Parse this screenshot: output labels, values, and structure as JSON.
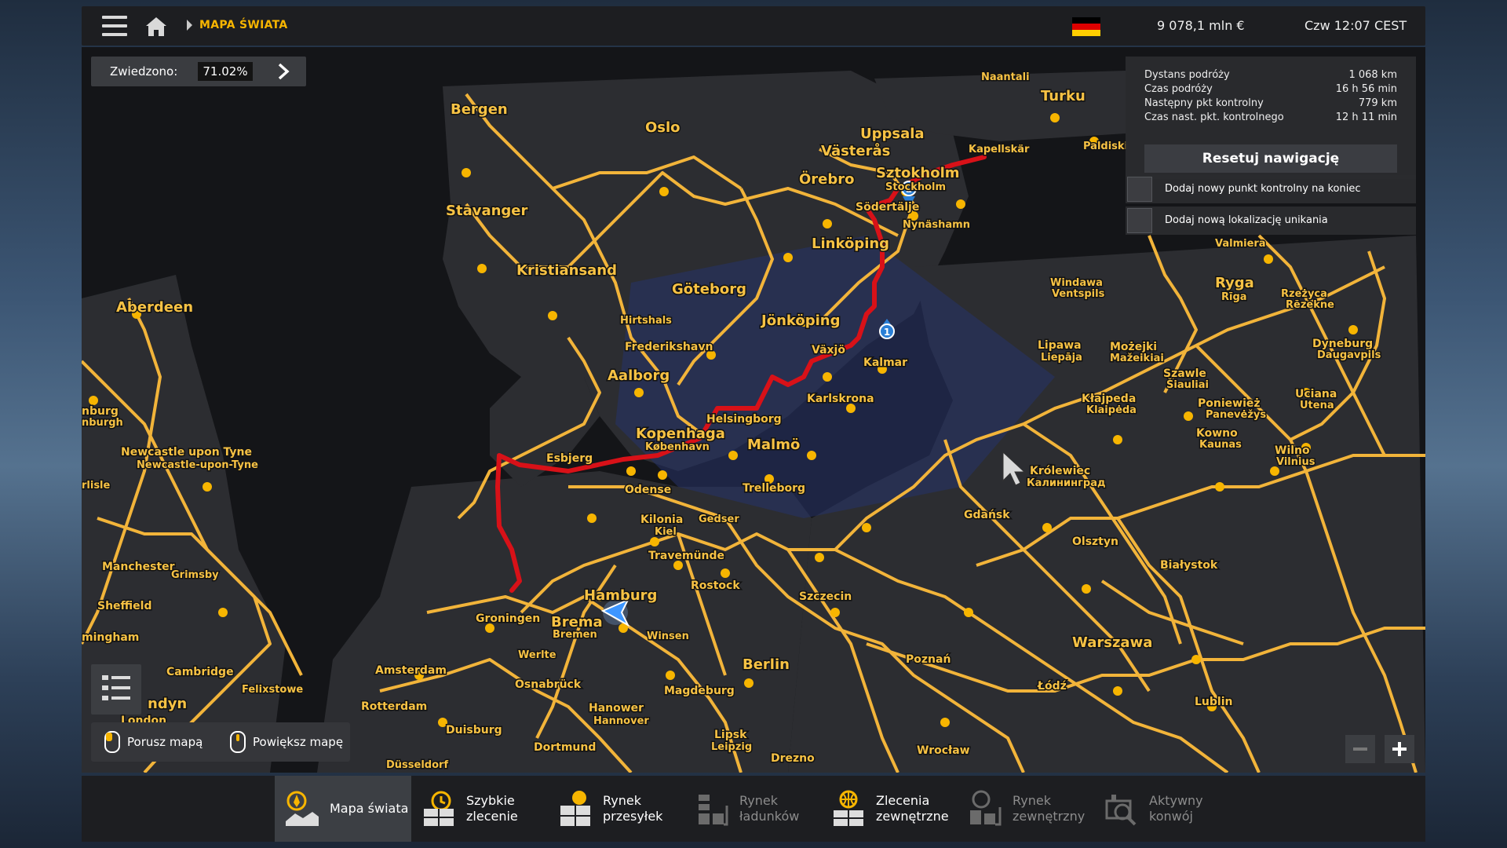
{
  "header": {
    "breadcrumb": "MAPA ŚWIATA",
    "money": "9 078,1 mln  €",
    "clock": "Czw 12:07 CEST",
    "flag_colors": [
      "#000000",
      "#dd0000",
      "#ffce00"
    ]
  },
  "visited": {
    "label": "Zwiedzono:",
    "value": "71.02%"
  },
  "navigation": {
    "rows": [
      {
        "label": "Dystans podróży",
        "value": "1 068 km"
      },
      {
        "label": "Czas podróży",
        "value": "16 h 56 min"
      },
      {
        "label": "Następny pkt kontrolny",
        "value": "779 km"
      },
      {
        "label": "Czas nast. pkt. kontrolnego",
        "value": "12 h 11 min"
      }
    ],
    "reset_label": "Resetuj nawigację",
    "options": [
      "Dodaj nowy punkt kontrolny na koniec",
      "Dodaj nową lokalizację unikania"
    ]
  },
  "map": {
    "route_color": "#d81118",
    "road_color": "#f2b43a",
    "waypoints": [
      "1",
      "2"
    ],
    "labels": {
      "bergen": "Bergen",
      "oslo": "Oslo",
      "stavanger": "Stavanger",
      "kristiansand": "Kristiansand",
      "aberdeen": "Aberdeen",
      "uppsala": "Uppsala",
      "vasteras": "Västerås",
      "orebro": "Örebro",
      "sztokholm": "Sztokholm",
      "stockholm": "Stockholm",
      "sodertalje": "Södertälje",
      "nynashamn": "Nynäshamn",
      "kapellskar": "Kapellskär",
      "naantali": "Naantali",
      "turku": "Turku",
      "paldiski": "Paldiski",
      "linkoping": "Linköping",
      "goteborg": "Göteborg",
      "jonkoping": "Jönköping",
      "hirtshals": "Hirtshals",
      "frederikshavn": "Frederikshavn",
      "vaxjo": "Växjö",
      "kalmar": "Kalmar",
      "aalborg": "Aalborg",
      "karlskrona": "Karlskrona",
      "helsingborg": "Helsingborg",
      "kopenhaga": "Kopenhaga",
      "kobenhavn": "København",
      "malmo": "Malmö",
      "esbjerg": "Esbjerg",
      "odense": "Odense",
      "trelleborg": "Trelleborg",
      "kilonia": "Kilonia",
      "kiel": "Kiel",
      "gedser": "Gedser",
      "travemunde": "Travemünde",
      "rostock": "Rostock",
      "hamburg": "Hamburg",
      "brema": "Brema",
      "bremen": "Bremen",
      "groningen": "Groningen",
      "winsen": "Winsen",
      "werlte": "Werlte",
      "amsterdam": "Amsterdam",
      "osnabruck": "Osnabrück",
      "hanower": "Hanower",
      "hannover": "Hannover",
      "magdeburg": "Magdeburg",
      "berlin": "Berlin",
      "rotterdam": "Rotterdam",
      "duisburg": "Duisburg",
      "dortmund": "Dortmund",
      "dusseldorf": "Düsseldorf",
      "lipsk": "Lipsk",
      "leipzig": "Leipzig",
      "drezno": "Drezno",
      "szczecin": "Szczecin",
      "gdansk": "Gdańsk",
      "olsztyn": "Olsztyn",
      "bialystok": "Białystok",
      "warszawa": "Warszawa",
      "poznan": "Poznań",
      "lodz": "Łódź",
      "lublin": "Lublin",
      "wroclaw": "Wrocław",
      "krolewiec": "Królewiec",
      "kaliningrad": "Калининград",
      "ryga": "Ryga",
      "riga": "Rīga",
      "windawa": "Windawa",
      "ventspils": "Ventspils",
      "lipawa": "Lipawa",
      "liepaja": "Liepāja",
      "mozejki": "Możejki",
      "mazeikiai": "Mažeikiai",
      "szawle": "Szawle",
      "siauliai": "Šiauliai",
      "klajpeda": "Kłajpeda",
      "klaipeda": "Klaipėda",
      "poniewiez": "Poniewież",
      "panevezys": "Panevėžys",
      "kowno": "Kowno",
      "kaunas": "Kaunas",
      "wilno": "Wilno",
      "vilnius": "Vilnius",
      "uciana": "Uciana",
      "utena": "Utena",
      "dyneburg": "Dyneburg",
      "daugavpils": "Daugavpils",
      "rzezyca": "Rzeżyca",
      "rezekne": "Rēzekne",
      "valmiera": "Valmiera",
      "newcastle": "Newcastle upon Tyne",
      "newcastle2": "Newcastle-upon-Tyne",
      "manchester": "Manchester",
      "grimsby": "Grimsby",
      "sheffield": "Sheffield",
      "birmingham": "mingham",
      "cambridge": "Cambridge",
      "felixstowe": "Felixstowe",
      "londyn": "ndyn",
      "london": "London",
      "edinburgh": "nburg",
      "edinburgh2": "nburgh",
      "carlisle": "rlisle"
    }
  },
  "controls": {
    "move_label": "Porusz mapą",
    "zoom_label": "Powiększ mapę"
  },
  "tabs": [
    {
      "label": "Mapa świata",
      "active": true,
      "dim": false,
      "icon": "world-map-icon"
    },
    {
      "label": "Szybkie\nzlecenie",
      "active": false,
      "dim": false,
      "icon": "quick-job-icon"
    },
    {
      "label": "Rynek\nprzesyłek",
      "active": false,
      "dim": false,
      "icon": "freight-market-icon"
    },
    {
      "label": "Rynek\nładunków",
      "active": false,
      "dim": true,
      "icon": "cargo-market-icon"
    },
    {
      "label": "Zlecenia\nzewnętrzne",
      "active": false,
      "dim": false,
      "icon": "external-contracts-icon"
    },
    {
      "label": "Rynek\nzewnętrzny",
      "active": false,
      "dim": true,
      "icon": "external-market-icon"
    },
    {
      "label": "Aktywny\nkonwój",
      "active": false,
      "dim": true,
      "icon": "active-convoy-icon"
    }
  ]
}
